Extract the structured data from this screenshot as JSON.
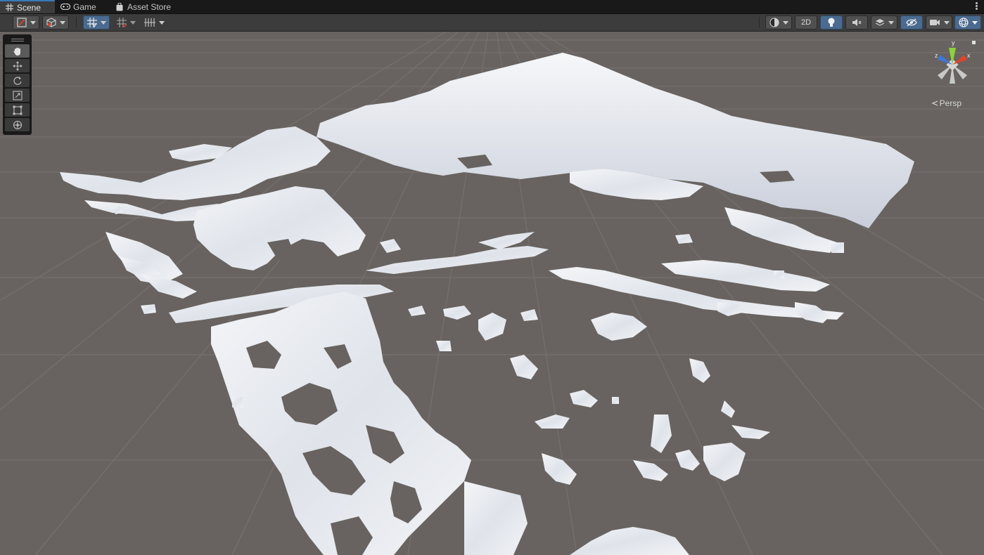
{
  "tabs": [
    {
      "label": "Scene",
      "icon": "grid-icon",
      "active": true
    },
    {
      "label": "Game",
      "icon": "gamepad-icon",
      "active": false
    },
    {
      "label": "Asset Store",
      "icon": "bag-icon",
      "active": false
    }
  ],
  "toolbar": {
    "toggle_2d_label": "2D",
    "buttons": [
      "draw-mode-icon",
      "shading-cube-icon",
      "grid-snap-icon",
      "incremental-snap-icon",
      "view-grid-icon",
      "render-sphere-icon",
      "lighting-bulb-icon",
      "audio-mute-icon",
      "effects-layers-icon",
      "hidden-objects-eye-icon",
      "camera-icon",
      "gizmos-icon"
    ]
  },
  "tools": [
    {
      "name": "hand-tool",
      "icon": "hand-icon",
      "active": true
    },
    {
      "name": "move-tool",
      "icon": "move-arrows-icon",
      "active": false
    },
    {
      "name": "rotate-tool",
      "icon": "rotate-icon",
      "active": false
    },
    {
      "name": "scale-tool",
      "icon": "scale-icon",
      "active": false
    },
    {
      "name": "rect-tool",
      "icon": "rect-icon",
      "active": false
    },
    {
      "name": "transform-tool",
      "icon": "transform-icon",
      "active": false
    }
  ],
  "gizmo": {
    "axis_x": "x",
    "axis_y": "y",
    "axis_z": "z",
    "projection_label": "Persp"
  },
  "colors": {
    "accent": "#4a6b8f",
    "viewport_bg": "#686360",
    "snow": "#eef0f4",
    "axis_x": "#e0432b",
    "axis_y": "#8fd13a",
    "axis_z": "#3e76d9"
  }
}
